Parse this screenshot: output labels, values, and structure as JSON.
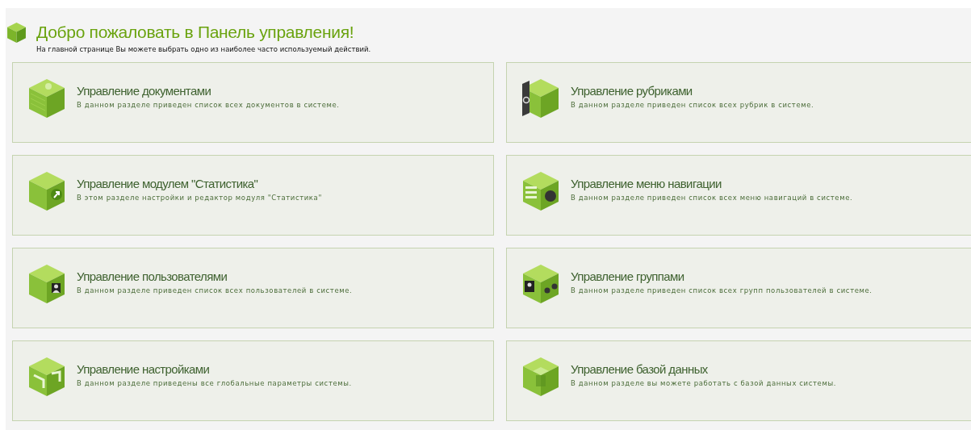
{
  "header": {
    "title": "Добро пожаловать в Панель управления!",
    "subtitle": "На главной странице Вы можете выбрать одно из наиболее часто используемый действий."
  },
  "sections": [
    {
      "title": "Управление документами",
      "description": "В данном разделе приведен список всех документов в системе."
    },
    {
      "title": "Управление рубриками",
      "description": "В данном разделе приведен список всех рубрик в системе."
    },
    {
      "title": "Управление модулем \"Статистика\"",
      "description": "В этом разделе настройки и редактор модуля \"Статистика\""
    },
    {
      "title": "Управление меню навигации",
      "description": "В данном разделе приведен список всех меню навигаций в системе."
    },
    {
      "title": "Управление пользователями",
      "description": "В данном разделе приведен список всех пользователей в системе."
    },
    {
      "title": "Управление группами",
      "description": "В данном разделе приведен список всех групп пользователей в системе."
    },
    {
      "title": "Управление настройками",
      "description": "В данном разделе приведены все глобальные параметры системы."
    },
    {
      "title": "Управление базой данных",
      "description": "В данном разделе вы можете работать с базой данных системы."
    }
  ]
}
